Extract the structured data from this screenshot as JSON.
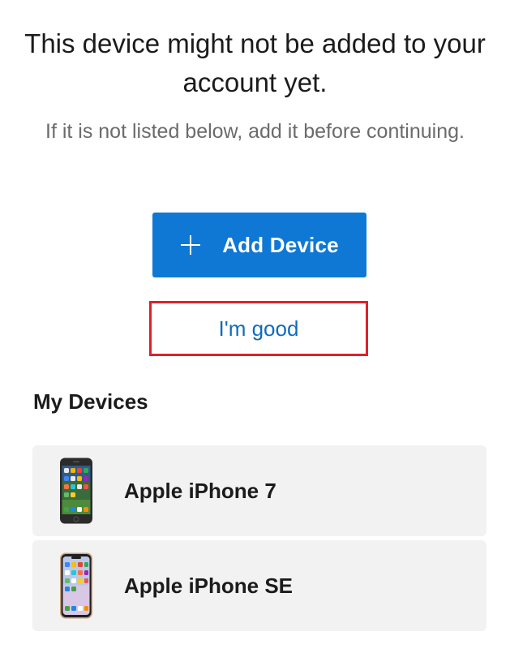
{
  "prompt": {
    "title": "This device might not be added to your account yet.",
    "subtitle": "If it is not listed below, add it before continuing."
  },
  "actions": {
    "add_device_label": "Add Device",
    "im_good_label": "I'm good"
  },
  "devices": {
    "heading": "My Devices",
    "items": [
      {
        "name": "Apple iPhone 7",
        "icon": "iphone-7-icon"
      },
      {
        "name": "Apple iPhone SE",
        "icon": "iphone-se-icon"
      }
    ]
  },
  "colors": {
    "primary": "#0f78d4",
    "link": "#0f6cbd",
    "highlight_border": "#e0202a",
    "row_background": "#f2f2f2"
  }
}
